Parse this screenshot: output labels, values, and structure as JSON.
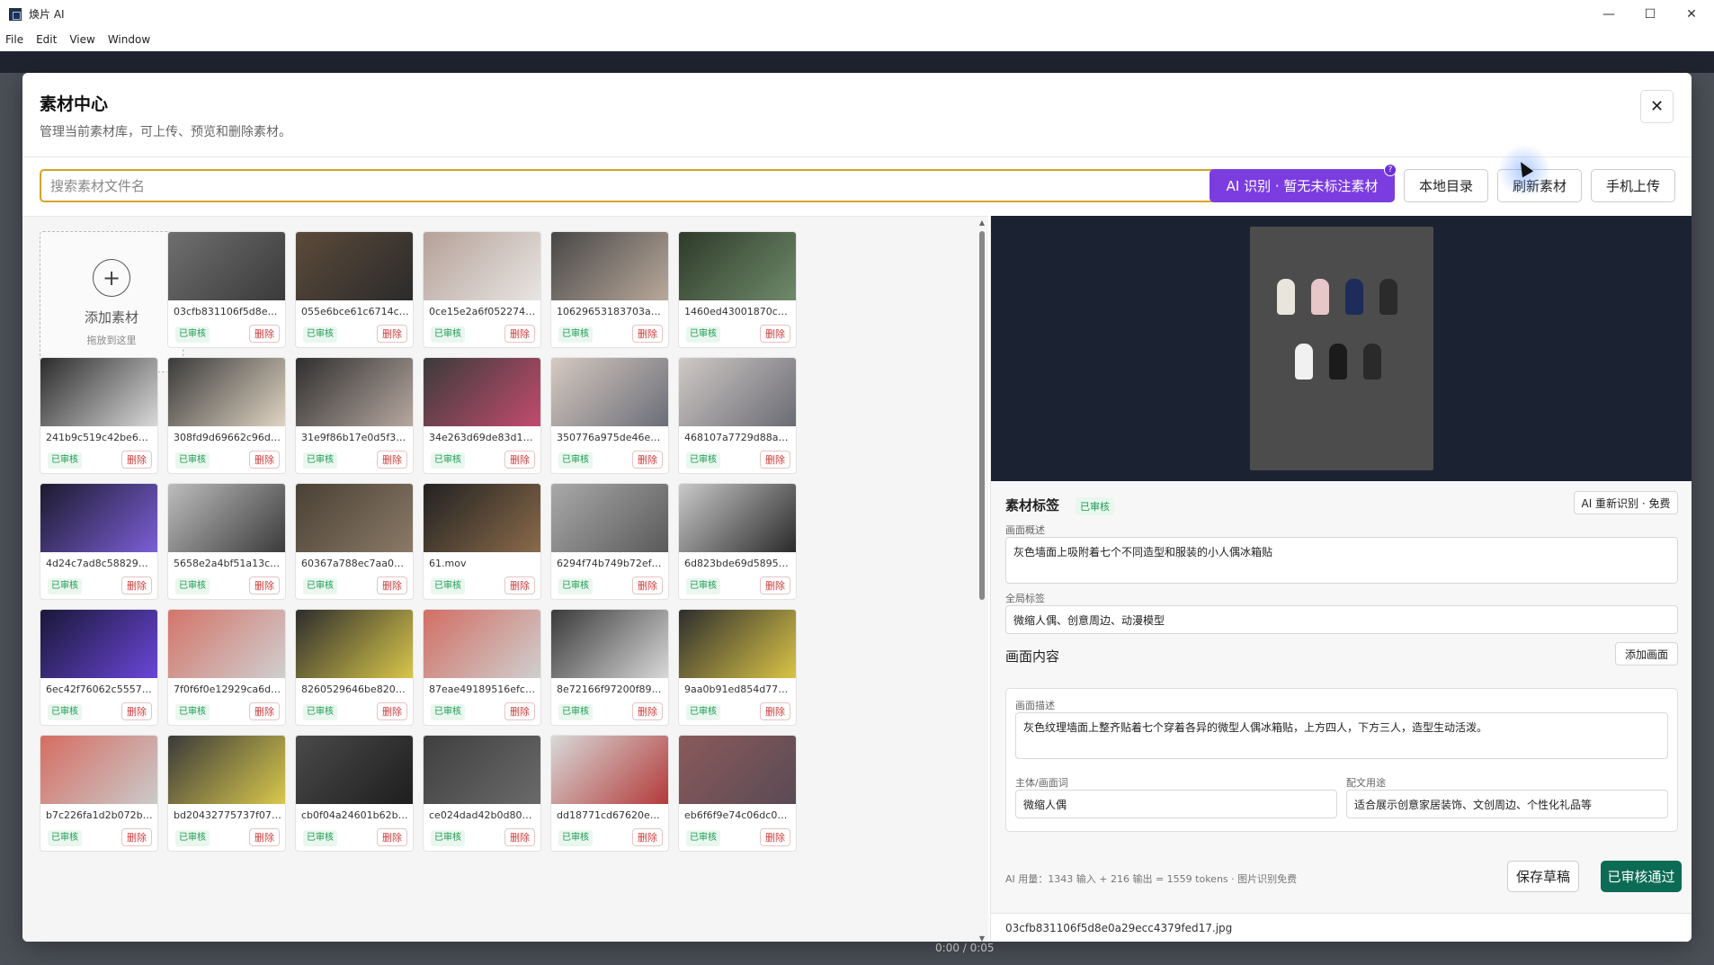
{
  "window": {
    "title": "焕片 AI",
    "controls": [
      "—",
      "☐",
      "✕"
    ]
  },
  "menu": [
    "File",
    "Edit",
    "View",
    "Window"
  ],
  "background": {
    "player_time": "0:00 / 0:05"
  },
  "modal": {
    "title": "素材中心",
    "subtitle": "管理当前素材库，可上传、预览和删除素材。",
    "close_glyph": "✕",
    "search_placeholder": "搜索素材文件名",
    "toolbar": {
      "ai_button": "AI 识别 · 暂无未标注素材",
      "help_glyph": "?",
      "local_dir": "本地目录",
      "refresh": "刷新素材",
      "phone_upload": "手机上传"
    },
    "add_card": {
      "plus": "+",
      "label": "添加素材",
      "hint": "拖放到这里"
    },
    "status_label": "已审核",
    "delete_label": "删除",
    "items": [
      {
        "file": "03cfb831106f5d8e0a29e...",
        "status": "已审核",
        "delete": "删除",
        "c1": "#6f6f6f",
        "c2": "#3a3a3a"
      },
      {
        "file": "055e6bce61c6714c6478...",
        "status": "已审核",
        "delete": "删除",
        "c1": "#5c4a3a",
        "c2": "#2b2b2b"
      },
      {
        "file": "0ce15e2a6f0522744dbbf...",
        "status": "已审核",
        "delete": "删除",
        "c1": "#b5a198",
        "c2": "#e8e5e2"
      },
      {
        "file": "10629653183703acb22d...",
        "status": "已审核",
        "delete": "删除",
        "c1": "#474747",
        "c2": "#b9a89a"
      },
      {
        "file": "1460ed43001870c02533...",
        "status": "已审核",
        "delete": "删除",
        "c1": "#2e3a2a",
        "c2": "#6f8a6a"
      },
      {
        "file": "241b9c519c42be6d3182...",
        "status": "已审核",
        "delete": "删除",
        "c1": "#2b2b2b",
        "c2": "#d9d9d9"
      },
      {
        "file": "308fd9d69662c96d9b0ff...",
        "status": "已审核",
        "delete": "删除",
        "c1": "#3a3a3a",
        "c2": "#e0d4c2"
      },
      {
        "file": "31e9f86b17e0d5f321ca9...",
        "status": "已审核",
        "delete": "删除",
        "c1": "#2f2f2f",
        "c2": "#b7a8a0"
      },
      {
        "file": "34e263d69de83d12446d...",
        "status": "已审核",
        "delete": "删除",
        "c1": "#3b3b3b",
        "c2": "#c24b6e"
      },
      {
        "file": "350776a975de46e519a3...",
        "status": "已审核",
        "delete": "删除",
        "c1": "#d6c9c0",
        "c2": "#6b6e78"
      },
      {
        "file": "468107a7729d88ada9f04...",
        "status": "已审核",
        "delete": "删除",
        "c1": "#cfc9c6",
        "c2": "#6a6b73"
      },
      {
        "file": "4d24c7ad8c588297f7026...",
        "status": "已审核",
        "delete": "删除",
        "c1": "#1c1a2e",
        "c2": "#7b5fd6"
      },
      {
        "file": "5658e2a4bf51a13c4075c...",
        "status": "已审核",
        "delete": "删除",
        "c1": "#bdbdbd",
        "c2": "#3b3b3b"
      },
      {
        "file": "60367a788ec7aa061448f...",
        "status": "已审核",
        "delete": "删除",
        "c1": "#4a4035",
        "c2": "#8a7a66"
      },
      {
        "file": "61.mov",
        "status": "已审核",
        "delete": "删除",
        "c1": "#222222",
        "c2": "#8a6a4a"
      },
      {
        "file": "6294f74b749b72ef9de4e...",
        "status": "已审核",
        "delete": "删除",
        "c1": "#a9a9a9",
        "c2": "#5a5a5a"
      },
      {
        "file": "6d823bde69d589591835...",
        "status": "已审核",
        "delete": "删除",
        "c1": "#c9c9c9",
        "c2": "#2a2a2a"
      },
      {
        "file": "6ec42f76062c555790d06...",
        "status": "已审核",
        "delete": "删除",
        "c1": "#1a1838",
        "c2": "#6a46d8"
      },
      {
        "file": "7f0f6f0e12929ca6d56fc8f...",
        "status": "已审核",
        "delete": "删除",
        "c1": "#d4746a",
        "c2": "#cfcfcf"
      },
      {
        "file": "8260529646be820e3f9b...",
        "status": "已审核",
        "delete": "删除",
        "c1": "#2d2d2d",
        "c2": "#d8c64a"
      },
      {
        "file": "87eae49189516efcd6de2...",
        "status": "已审核",
        "delete": "删除",
        "c1": "#d26e64",
        "c2": "#cfcfcf"
      },
      {
        "file": "8e72166f97200f896e0cfa...",
        "status": "已审核",
        "delete": "删除",
        "c1": "#3a3a3a",
        "c2": "#d8d8d8"
      },
      {
        "file": "9aa0b91ed854d77c15ed...",
        "status": "已审核",
        "delete": "删除",
        "c1": "#2e2e2e",
        "c2": "#d9c446"
      },
      {
        "file": "b7c226fa1d2b072b6b1b...",
        "status": "已审核",
        "delete": "删除",
        "c1": "#d66d62",
        "c2": "#cacaca"
      },
      {
        "file": "bd20432775737f07c62a6...",
        "status": "已审核",
        "delete": "删除",
        "c1": "#3a3a3a",
        "c2": "#d8c84c"
      },
      {
        "file": "cb0f04a24601b62b09386...",
        "status": "已审核",
        "delete": "删除",
        "c1": "#4a4a4a",
        "c2": "#1e1e1e"
      },
      {
        "file": "ce024dad42b0d8026114...",
        "status": "已审核",
        "delete": "删除",
        "c1": "#3f3f3f",
        "c2": "#6a6a6a"
      },
      {
        "file": "dd18771cd67620e17245...",
        "status": "已审核",
        "delete": "删除",
        "c1": "#d8d8d8",
        "c2": "#b33a3a"
      },
      {
        "file": "eb6f6f9e74c06dc00107c2...",
        "status": "已审核",
        "delete": "删除",
        "c1": "#8a5a5a",
        "c2": "#5a4a55"
      }
    ],
    "detail": {
      "section_title": "素材标签",
      "status": "已审核",
      "re_ai": "AI 重新识别 · 免费",
      "overview_label": "画面概述",
      "overview": "灰色墙面上吸附着七个不同造型和服装的小人偶冰箱贴",
      "global_tags_label": "全局标签",
      "global_tags": "微缩人偶、创意周边、动漫模型",
      "content_title": "画面内容",
      "add_scene": "添加画面",
      "scene_desc_label": "画面描述",
      "scene_desc": "灰色纹理墙面上整齐贴着七个穿着各异的微型人偶冰箱贴，上方四人，下方三人，造型生动活泼。",
      "subject_label": "主体/画面词",
      "subject": "微缩人偶",
      "usage_label": "配文用途",
      "usage": "适合展示创意家居装饰、文创周边、个性化礼品等",
      "ai_usage": "AI 用量：1343 输入 + 216 输出 = 1559 tokens · 图片识别免费",
      "save_draft": "保存草稿",
      "approve": "已审核通过",
      "selected_file": "03cfb831106f5d8e0a29ecc4379fed17.jpg"
    },
    "preview_figures": [
      {
        "c": "#e9e4dc"
      },
      {
        "c": "#e7c6c8"
      },
      {
        "c": "#1e2c5a"
      },
      {
        "c": "#2b2b2b"
      },
      {
        "c": "#f1f1f1"
      },
      {
        "c": "#1b1b1b"
      },
      {
        "c": "#2a2a2a"
      }
    ]
  }
}
